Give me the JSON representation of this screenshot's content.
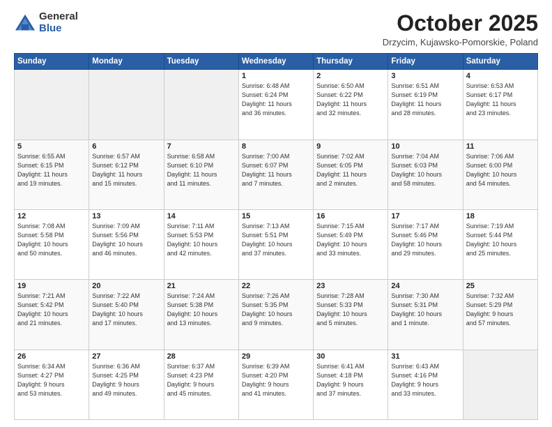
{
  "logo": {
    "general": "General",
    "blue": "Blue"
  },
  "title": "October 2025",
  "subtitle": "Drzycim, Kujawsko-Pomorskie, Poland",
  "days_of_week": [
    "Sunday",
    "Monday",
    "Tuesday",
    "Wednesday",
    "Thursday",
    "Friday",
    "Saturday"
  ],
  "weeks": [
    [
      {
        "day": "",
        "info": ""
      },
      {
        "day": "",
        "info": ""
      },
      {
        "day": "",
        "info": ""
      },
      {
        "day": "1",
        "info": "Sunrise: 6:48 AM\nSunset: 6:24 PM\nDaylight: 11 hours\nand 36 minutes."
      },
      {
        "day": "2",
        "info": "Sunrise: 6:50 AM\nSunset: 6:22 PM\nDaylight: 11 hours\nand 32 minutes."
      },
      {
        "day": "3",
        "info": "Sunrise: 6:51 AM\nSunset: 6:19 PM\nDaylight: 11 hours\nand 28 minutes."
      },
      {
        "day": "4",
        "info": "Sunrise: 6:53 AM\nSunset: 6:17 PM\nDaylight: 11 hours\nand 23 minutes."
      }
    ],
    [
      {
        "day": "5",
        "info": "Sunrise: 6:55 AM\nSunset: 6:15 PM\nDaylight: 11 hours\nand 19 minutes."
      },
      {
        "day": "6",
        "info": "Sunrise: 6:57 AM\nSunset: 6:12 PM\nDaylight: 11 hours\nand 15 minutes."
      },
      {
        "day": "7",
        "info": "Sunrise: 6:58 AM\nSunset: 6:10 PM\nDaylight: 11 hours\nand 11 minutes."
      },
      {
        "day": "8",
        "info": "Sunrise: 7:00 AM\nSunset: 6:07 PM\nDaylight: 11 hours\nand 7 minutes."
      },
      {
        "day": "9",
        "info": "Sunrise: 7:02 AM\nSunset: 6:05 PM\nDaylight: 11 hours\nand 2 minutes."
      },
      {
        "day": "10",
        "info": "Sunrise: 7:04 AM\nSunset: 6:03 PM\nDaylight: 10 hours\nand 58 minutes."
      },
      {
        "day": "11",
        "info": "Sunrise: 7:06 AM\nSunset: 6:00 PM\nDaylight: 10 hours\nand 54 minutes."
      }
    ],
    [
      {
        "day": "12",
        "info": "Sunrise: 7:08 AM\nSunset: 5:58 PM\nDaylight: 10 hours\nand 50 minutes."
      },
      {
        "day": "13",
        "info": "Sunrise: 7:09 AM\nSunset: 5:56 PM\nDaylight: 10 hours\nand 46 minutes."
      },
      {
        "day": "14",
        "info": "Sunrise: 7:11 AM\nSunset: 5:53 PM\nDaylight: 10 hours\nand 42 minutes."
      },
      {
        "day": "15",
        "info": "Sunrise: 7:13 AM\nSunset: 5:51 PM\nDaylight: 10 hours\nand 37 minutes."
      },
      {
        "day": "16",
        "info": "Sunrise: 7:15 AM\nSunset: 5:49 PM\nDaylight: 10 hours\nand 33 minutes."
      },
      {
        "day": "17",
        "info": "Sunrise: 7:17 AM\nSunset: 5:46 PM\nDaylight: 10 hours\nand 29 minutes."
      },
      {
        "day": "18",
        "info": "Sunrise: 7:19 AM\nSunset: 5:44 PM\nDaylight: 10 hours\nand 25 minutes."
      }
    ],
    [
      {
        "day": "19",
        "info": "Sunrise: 7:21 AM\nSunset: 5:42 PM\nDaylight: 10 hours\nand 21 minutes."
      },
      {
        "day": "20",
        "info": "Sunrise: 7:22 AM\nSunset: 5:40 PM\nDaylight: 10 hours\nand 17 minutes."
      },
      {
        "day": "21",
        "info": "Sunrise: 7:24 AM\nSunset: 5:38 PM\nDaylight: 10 hours\nand 13 minutes."
      },
      {
        "day": "22",
        "info": "Sunrise: 7:26 AM\nSunset: 5:35 PM\nDaylight: 10 hours\nand 9 minutes."
      },
      {
        "day": "23",
        "info": "Sunrise: 7:28 AM\nSunset: 5:33 PM\nDaylight: 10 hours\nand 5 minutes."
      },
      {
        "day": "24",
        "info": "Sunrise: 7:30 AM\nSunset: 5:31 PM\nDaylight: 10 hours\nand 1 minute."
      },
      {
        "day": "25",
        "info": "Sunrise: 7:32 AM\nSunset: 5:29 PM\nDaylight: 9 hours\nand 57 minutes."
      }
    ],
    [
      {
        "day": "26",
        "info": "Sunrise: 6:34 AM\nSunset: 4:27 PM\nDaylight: 9 hours\nand 53 minutes."
      },
      {
        "day": "27",
        "info": "Sunrise: 6:36 AM\nSunset: 4:25 PM\nDaylight: 9 hours\nand 49 minutes."
      },
      {
        "day": "28",
        "info": "Sunrise: 6:37 AM\nSunset: 4:23 PM\nDaylight: 9 hours\nand 45 minutes."
      },
      {
        "day": "29",
        "info": "Sunrise: 6:39 AM\nSunset: 4:20 PM\nDaylight: 9 hours\nand 41 minutes."
      },
      {
        "day": "30",
        "info": "Sunrise: 6:41 AM\nSunset: 4:18 PM\nDaylight: 9 hours\nand 37 minutes."
      },
      {
        "day": "31",
        "info": "Sunrise: 6:43 AM\nSunset: 4:16 PM\nDaylight: 9 hours\nand 33 minutes."
      },
      {
        "day": "",
        "info": ""
      }
    ]
  ]
}
